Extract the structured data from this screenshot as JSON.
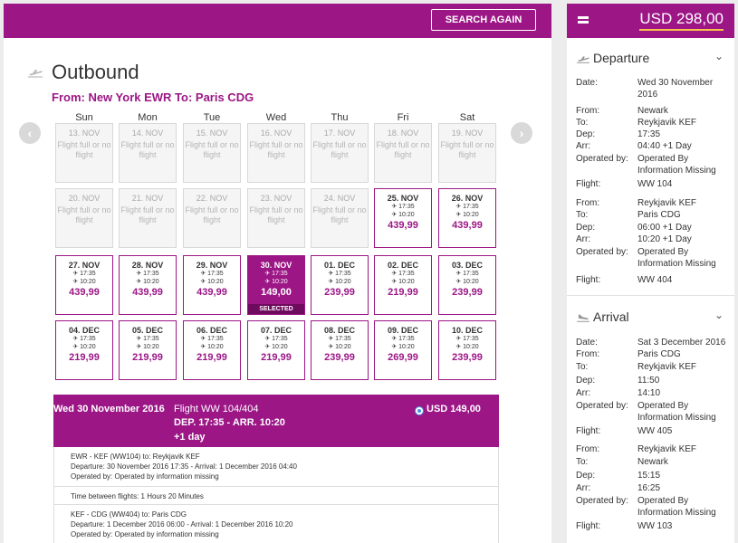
{
  "header": {
    "search_again_label": "SEARCH AGAIN"
  },
  "outbound": {
    "title": "Outbound",
    "route": "From: New York EWR To: Paris CDG",
    "weekdays": [
      "Sun",
      "Mon",
      "Tue",
      "Wed",
      "Thu",
      "Fri",
      "Sat"
    ],
    "weeks": [
      [
        {
          "date": "13. NOV",
          "no_flight": "Flight full or no flight"
        },
        {
          "date": "14. NOV",
          "no_flight": "Flight full or no flight"
        },
        {
          "date": "15. NOV",
          "no_flight": "Flight full or no flight"
        },
        {
          "date": "16. NOV",
          "no_flight": "Flight full or no flight"
        },
        {
          "date": "17. NOV",
          "no_flight": "Flight full or no flight"
        },
        {
          "date": "18. NOV",
          "no_flight": "Flight full or no flight"
        },
        {
          "date": "19. NOV",
          "no_flight": "Flight full or no flight"
        }
      ],
      [
        {
          "date": "20. NOV",
          "no_flight": "Flight full or no flight"
        },
        {
          "date": "21. NOV",
          "no_flight": "Flight full or no flight"
        },
        {
          "date": "22. NOV",
          "no_flight": "Flight full or no flight"
        },
        {
          "date": "23. NOV",
          "no_flight": "Flight full or no flight"
        },
        {
          "date": "24. NOV",
          "no_flight": "Flight full or no flight"
        },
        {
          "date": "25. NOV",
          "dep": "17:35",
          "arr": "10:20",
          "price": "439,99"
        },
        {
          "date": "26. NOV",
          "dep": "17:35",
          "arr": "10:20",
          "price": "439,99"
        }
      ],
      [
        {
          "date": "27. NOV",
          "dep": "17:35",
          "arr": "10:20",
          "price": "439,99"
        },
        {
          "date": "28. NOV",
          "dep": "17:35",
          "arr": "10:20",
          "price": "439,99"
        },
        {
          "date": "29. NOV",
          "dep": "17:35",
          "arr": "10:20",
          "price": "439,99"
        },
        {
          "date": "30. NOV",
          "dep": "17:35",
          "arr": "10:20",
          "price": "149,00",
          "selected": "SELECTED"
        },
        {
          "date": "01. DEC",
          "dep": "17:35",
          "arr": "10:20",
          "price": "239,99"
        },
        {
          "date": "02. DEC",
          "dep": "17:35",
          "arr": "10:20",
          "price": "219,99"
        },
        {
          "date": "03. DEC",
          "dep": "17:35",
          "arr": "10:20",
          "price": "239,99"
        }
      ],
      [
        {
          "date": "04. DEC",
          "dep": "17:35",
          "arr": "10:20",
          "price": "219,99"
        },
        {
          "date": "05. DEC",
          "dep": "17:35",
          "arr": "10:20",
          "price": "219,99"
        },
        {
          "date": "06. DEC",
          "dep": "17:35",
          "arr": "10:20",
          "price": "219,99"
        },
        {
          "date": "07. DEC",
          "dep": "17:35",
          "arr": "10:20",
          "price": "219,99"
        },
        {
          "date": "08. DEC",
          "dep": "17:35",
          "arr": "10:20",
          "price": "239,99"
        },
        {
          "date": "09. DEC",
          "dep": "17:35",
          "arr": "10:20",
          "price": "269,99"
        },
        {
          "date": "10. DEC",
          "dep": "17:35",
          "arr": "10:20",
          "price": "239,99"
        }
      ]
    ]
  },
  "summary": {
    "date": "Wed 30 November 2016",
    "flight": "Flight   WW 104/404",
    "dep_arr": "DEP. 17:35 - ARR. 10:20",
    "plus_day": "+1 day",
    "price": "USD 149,00",
    "leg1": {
      "title": "EWR - KEF (WW104) to: Reykjavik KEF",
      "times": "Departure: 30 November 2016 17:35 - Arrival: 1 December 2016 04:40",
      "operated": "Operated by: Operated by information missing"
    },
    "connection": "Time between flights: 1 Hours 20 Minutes",
    "leg2": {
      "title": "KEF - CDG (WW404) to: Paris CDG",
      "times": "Departure: 1 December 2016 06:00 - Arrival: 1 December 2016 10:20",
      "operated": "Operated by: Operated by information missing"
    }
  },
  "sidebar": {
    "total": "USD 298,00",
    "departure": {
      "title": "Departure",
      "rows": [
        {
          "k": "Date:",
          "v": "Wed 30 November 2016"
        },
        {
          "k": "From:",
          "v": "Newark"
        },
        {
          "k": "To:",
          "v": "Reykjavik KEF"
        },
        {
          "k": "Dep:",
          "v": "17:35"
        },
        {
          "k": "Arr:",
          "v": "04:40 +1 Day"
        },
        {
          "k": "Operated by:",
          "v": "Operated By Information Missing"
        },
        {
          "k": "Flight:",
          "v": "WW 104"
        },
        {
          "k": "From:",
          "v": "Reykjavik KEF"
        },
        {
          "k": "To:",
          "v": "Paris CDG"
        },
        {
          "k": "Dep:",
          "v": "06:00 +1 Day"
        },
        {
          "k": "Arr:",
          "v": "10:20 +1 Day"
        },
        {
          "k": "Operated by:",
          "v": "Operated By Information Missing"
        },
        {
          "k": "Flight:",
          "v": "WW 404"
        }
      ]
    },
    "arrival": {
      "title": "Arrival",
      "rows": [
        {
          "k": "Date:",
          "v": "Sat 3 December 2016"
        },
        {
          "k": "From:",
          "v": "Paris CDG"
        },
        {
          "k": "To:",
          "v": "Reykjavik KEF"
        },
        {
          "k": "Dep:",
          "v": "11:50"
        },
        {
          "k": "Arr:",
          "v": "14:10"
        },
        {
          "k": "Operated by:",
          "v": "Operated By Information Missing"
        },
        {
          "k": "Flight:",
          "v": "WW 405"
        },
        {
          "k": "From:",
          "v": "Reykjavik KEF"
        },
        {
          "k": "To:",
          "v": "Newark"
        },
        {
          "k": "Dep:",
          "v": "15:15"
        },
        {
          "k": "Arr:",
          "v": "16:25"
        },
        {
          "k": "Operated by:",
          "v": "Operated By Information Missing"
        },
        {
          "k": "Flight:",
          "v": "WW 103"
        }
      ]
    }
  }
}
